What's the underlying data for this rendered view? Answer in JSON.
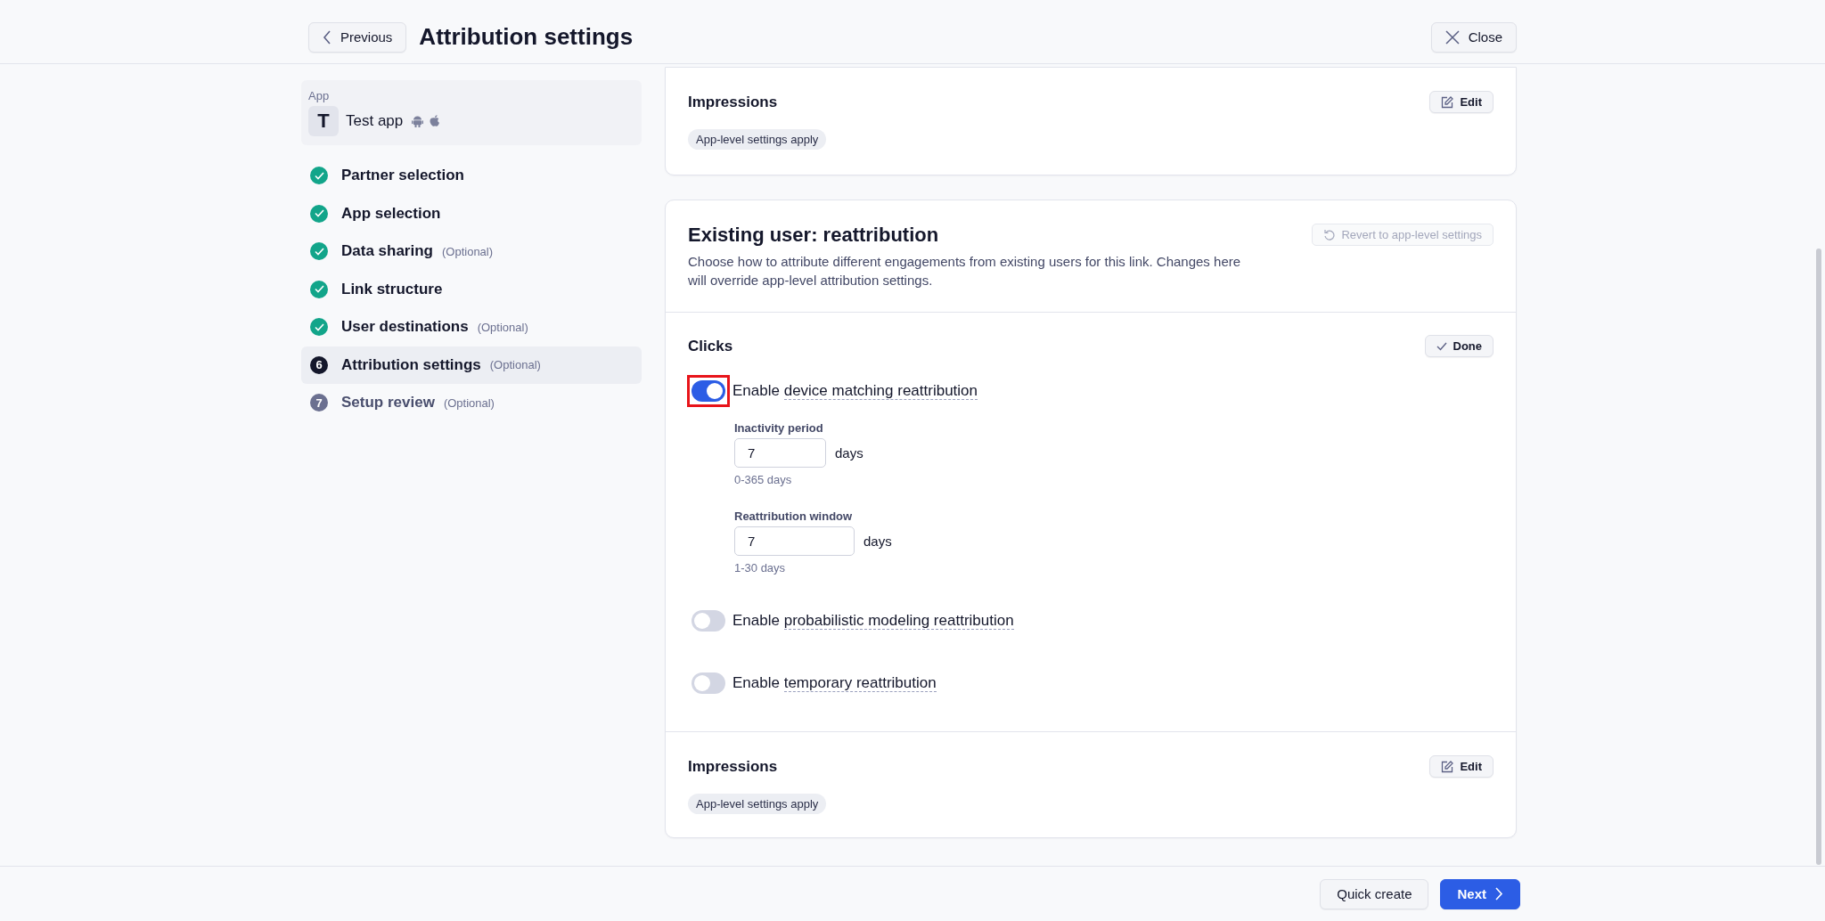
{
  "header": {
    "back_button": "Previous",
    "title": "Attribution settings",
    "close_button": "Close"
  },
  "sidebar": {
    "app": {
      "label": "App",
      "initial": "T",
      "name": "Test app"
    },
    "steps": [
      {
        "label": "Partner selection",
        "done": true,
        "selected": false
      },
      {
        "label": "App selection",
        "done": true,
        "selected": false
      },
      {
        "label": "Data sharing",
        "note": "(Optional)",
        "done": true,
        "selected": false
      },
      {
        "label": "Link structure",
        "done": true,
        "selected": false
      },
      {
        "label": "User destinations",
        "note": "(Optional)",
        "done": true,
        "selected": false
      },
      {
        "label": "Attribution settings",
        "note": "(Optional)",
        "done": false,
        "number": "6",
        "selected": true
      },
      {
        "label": "Setup review",
        "note": "(Optional)",
        "done": false,
        "number": "7",
        "selected": false
      }
    ]
  },
  "top_card": {
    "title": "Impressions",
    "edit_button": "Edit",
    "badge": "App-level settings apply"
  },
  "reattribution_card": {
    "title": "Existing user: reattribution",
    "description": "Choose how to attribute different engagements from existing users for this link. Changes here will override app-level attribution settings.",
    "revert_button": "Revert to app-level settings",
    "revert_disabled": true,
    "clicks": {
      "title": "Clicks",
      "done_button": "Done",
      "toggles": [
        {
          "prefix": "Enable",
          "term": "device matching reattribution",
          "on": true,
          "highlighted": true,
          "fields": [
            {
              "label": "Inactivity period",
              "value": "7",
              "unit": "days",
              "hint": "0-365 days"
            },
            {
              "label": "Reattribution window",
              "value": "7",
              "unit": "days",
              "hint": "1-30 days"
            }
          ]
        },
        {
          "prefix": "Enable",
          "term": "probabilistic modeling reattribution",
          "on": false,
          "highlighted": false
        },
        {
          "prefix": "Enable",
          "term": "temporary reattribution",
          "on": false,
          "highlighted": false
        }
      ]
    },
    "impressions": {
      "title": "Impressions",
      "edit_button": "Edit",
      "badge": "App-level settings apply"
    }
  },
  "footer": {
    "buttons": [
      {
        "label": "Quick create",
        "kind": "secondary"
      },
      {
        "label": "Next",
        "kind": "primary"
      }
    ]
  }
}
